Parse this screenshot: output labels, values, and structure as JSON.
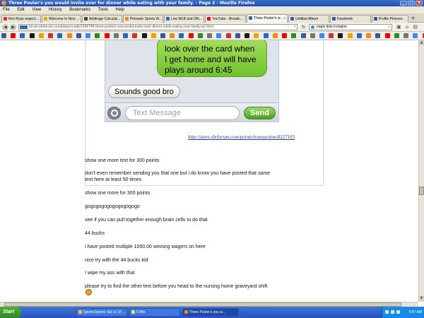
{
  "window": {
    "title": "Three Poster's you would invite over for dinner while eating with your family. - Page 2 - Mozilla Firefox"
  },
  "menu": [
    "File",
    "Edit",
    "View",
    "History",
    "Bookmarks",
    "Tools",
    "Help"
  ],
  "tabs": [
    {
      "label": "Rex Ryan expect...",
      "active": false
    },
    {
      "label": "Welcome to New ...",
      "active": false
    },
    {
      "label": "Arbitrage Calculat...",
      "active": false
    },
    {
      "label": "Pinnacle Sports W...",
      "active": false
    },
    {
      "label": "Live MLB and Oth...",
      "active": false
    },
    {
      "label": "YouTube - Broadc...",
      "active": false
    },
    {
      "label": "Three Poster's w...",
      "active": true
    },
    {
      "label": "Untitled Album",
      "active": false
    },
    {
      "label": "Facebook",
      "active": false
    },
    {
      "label": "Profile Pictures",
      "active": false
    }
  ],
  "address": {
    "site_badge": "SBR",
    "url": "forum.sbrforum.com/players-talk/1646746-three-posters-you-would-invite-over-dinner-while-eating-your-family-p2.html"
  },
  "search": {
    "value": "eagle tints irvington"
  },
  "post": {
    "green_bubble": "look over the card when I get home and will have plays around 6:45",
    "gray_bubble": "Sounds good bro",
    "message_placeholder": "Text Message",
    "send_label": "Send",
    "attachment_link": "http://store.sbrforum.com/points/transaction/4327103",
    "lines": [
      "show one more text for 300 points",
      "don't even remember sending you that one but i do know you have posted that same",
      "text here at least 50 times",
      "show one more for 300 points",
      "gogogogogogogogogogo",
      "see if you can pull together enough brain cells to do that",
      "44 bucks",
      "i have posted multiple 1000.00 winning wagers on here",
      "nice try with the 44 bucks kid",
      "I wipe my ass with that",
      "please try to find the other text before you head to the nursing home graveyard shift"
    ]
  },
  "taskbar": {
    "start_label": "Start",
    "items": [
      {
        "label": "SportsOptions Std v2.1F ...",
        "active": false
      },
      {
        "label": "5 IMs",
        "active": false
      },
      {
        "label": "Three Poster's you w...",
        "active": true
      }
    ],
    "clock": "9:57 AM"
  },
  "colors": {
    "title_bar": "#1d4fb0",
    "imessage_green": "#72c12f",
    "link_blue": "#1d3ea8",
    "taskbar_blue": "#2555be",
    "start_green": "#2e8a22"
  }
}
